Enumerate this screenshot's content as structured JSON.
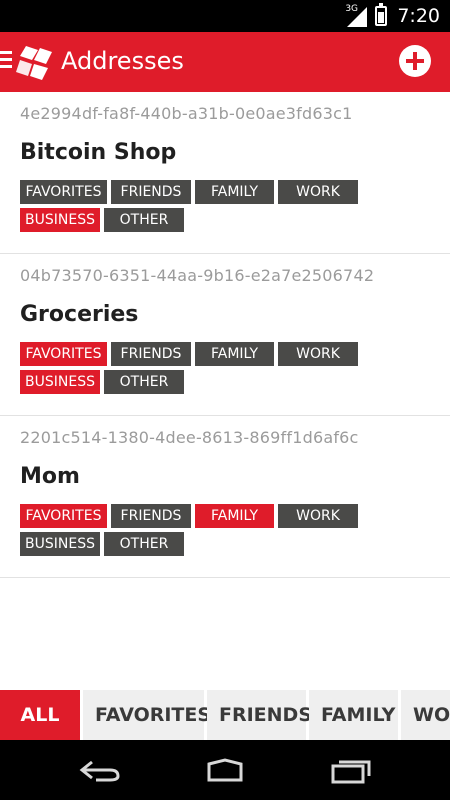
{
  "status_bar": {
    "network": "3G",
    "time": "7:20",
    "battery_level": 0.7
  },
  "action_bar": {
    "title": "Addresses",
    "menu_icon": "hamburger-menu-icon",
    "logo": "app-logo",
    "add_icon": "add-circle-icon",
    "accent_color": "#df1c2a"
  },
  "entries": [
    {
      "uuid": "4e2994df-fa8f-440b-a31b-0e0ae3fd63c1",
      "name": "Bitcoin Shop",
      "tags": [
        {
          "label": "FAVORITES",
          "active": false
        },
        {
          "label": "FRIENDS",
          "active": false
        },
        {
          "label": "FAMILY",
          "active": false
        },
        {
          "label": "WORK",
          "active": false
        },
        {
          "label": "BUSINESS",
          "active": true
        },
        {
          "label": "OTHER",
          "active": false
        }
      ]
    },
    {
      "uuid": "04b73570-6351-44aa-9b16-e2a7e2506742",
      "name": "Groceries",
      "tags": [
        {
          "label": "FAVORITES",
          "active": true
        },
        {
          "label": "FRIENDS",
          "active": false
        },
        {
          "label": "FAMILY",
          "active": false
        },
        {
          "label": "WORK",
          "active": false
        },
        {
          "label": "BUSINESS",
          "active": true
        },
        {
          "label": "OTHER",
          "active": false
        }
      ]
    },
    {
      "uuid": "2201c514-1380-4dee-8613-869ff1d6af6c",
      "name": "Mom",
      "tags": [
        {
          "label": "FAVORITES",
          "active": true
        },
        {
          "label": "FRIENDS",
          "active": false
        },
        {
          "label": "FAMILY",
          "active": true
        },
        {
          "label": "WORK",
          "active": false
        },
        {
          "label": "BUSINESS",
          "active": false
        },
        {
          "label": "OTHER",
          "active": false
        }
      ]
    }
  ],
  "filter_tabs": [
    {
      "label": "ALL",
      "active": true
    },
    {
      "label": "FAVORITES",
      "active": false
    },
    {
      "label": "FRIENDS",
      "active": false
    },
    {
      "label": "FAMILY",
      "active": false
    },
    {
      "label": "WORK",
      "active": false
    }
  ],
  "nav_bar": {
    "icons": [
      "back-icon",
      "home-icon",
      "recent-apps-icon"
    ]
  }
}
